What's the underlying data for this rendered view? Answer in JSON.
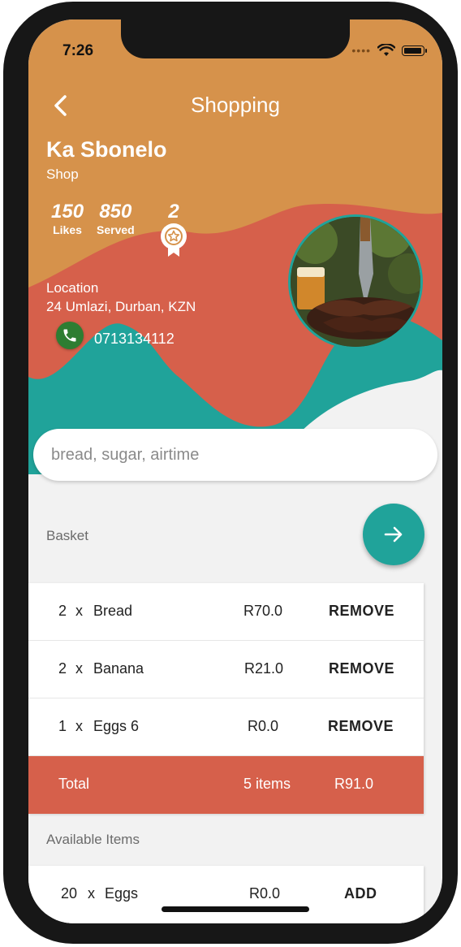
{
  "status_bar": {
    "time": "7:26",
    "signal_icon": "cellular-dots-icon",
    "wifi_icon": "wifi-icon",
    "battery_icon": "battery-icon"
  },
  "header": {
    "title": "Shopping",
    "back_icon": "chevron-left-icon"
  },
  "shop": {
    "name": "Ka Sbonelo",
    "type": "Shop",
    "stats": [
      {
        "value": "150",
        "label": "Likes"
      },
      {
        "value": "850",
        "label": "Served"
      },
      {
        "value": "2",
        "label": "",
        "icon": "award-badge-icon"
      }
    ],
    "location_label": "Location",
    "location": "24 Umlazi, Durban, KZN",
    "phone": "0713134112",
    "phone_icon": "phone-icon"
  },
  "search": {
    "placeholder": "bread, sugar, airtime"
  },
  "basket": {
    "label": "Basket",
    "checkout_icon": "arrow-right-icon",
    "items": [
      {
        "qty": "2",
        "x": "x",
        "name": "Bread",
        "price": "R70.0",
        "action": "REMOVE"
      },
      {
        "qty": "2",
        "x": "x",
        "name": "Banana",
        "price": "R21.0",
        "action": "REMOVE"
      },
      {
        "qty": "1",
        "x": "x",
        "name": "Eggs 6",
        "price": "R0.0",
        "action": "REMOVE"
      }
    ],
    "total": {
      "label": "Total",
      "count": "5 items",
      "amount": "R91.0"
    }
  },
  "available": {
    "label": "Available Items",
    "items": [
      {
        "qty": "20",
        "x": "x",
        "name": "Eggs",
        "price": "R0.0",
        "action": "ADD"
      }
    ]
  },
  "colors": {
    "orange": "#d6924b",
    "red": "#d6604b",
    "teal": "#20a39a",
    "background": "#f2f2f2",
    "phone_green": "#2e7d32"
  }
}
